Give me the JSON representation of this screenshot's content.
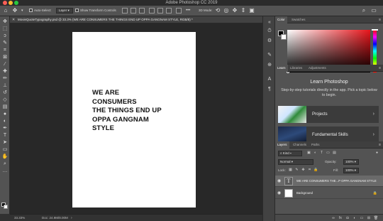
{
  "window": {
    "title": "Adobe Photoshop CC 2019"
  },
  "options_bar": {
    "home_icon": "home-icon",
    "move_icon": "move-tool-icon",
    "auto_select_label": "Auto-Select:",
    "auto_select_value": "Layer",
    "transform_label": "Show Transform Controls",
    "mode_label": "3D Mode:"
  },
  "document": {
    "tab_label": "MovieQuoteTypography.psd @ 33.3% (WE ARE CONSUMERS THE THINGS END UP OPPA GANGNAM STYLE, RGB/8) *",
    "quote_lines": [
      "WE ARE",
      "CONSUMERS",
      "THE THINGS END UP",
      "OPPA GANGNAM",
      "STYLE"
    ]
  },
  "status": {
    "zoom": "33.33%",
    "doc": "Doc: 24.9M/8.00M"
  },
  "color_panel": {
    "tabs": [
      "Color",
      "Swatches"
    ],
    "foreground": "#000000",
    "background": "#ffffff",
    "hue": "#e8151b"
  },
  "learn_panel": {
    "tabs": [
      "Learn",
      "Libraries",
      "Adjustments"
    ],
    "title": "Learn Photoshop",
    "description": "Step-by-step tutorials directly in the app. Pick a topic below to begin.",
    "cards": [
      {
        "label": "Projects"
      },
      {
        "label": "Fundamental Skills"
      }
    ]
  },
  "layers_panel": {
    "tabs": [
      "Layers",
      "Channels",
      "Paths"
    ],
    "filter_kind": "Kind",
    "blend_mode": "Normal",
    "opacity_label": "Opacity:",
    "opacity_value": "100%",
    "lock_label": "Lock:",
    "fill_label": "Fill:",
    "fill_value": "100%",
    "layers": [
      {
        "name": "WE ARE CONSUMERS THE...P OPPA GANGNAM STYLE",
        "type": "text",
        "thumb": "T",
        "selected": true
      },
      {
        "name": "Background",
        "type": "pixel",
        "selected": false
      }
    ]
  }
}
